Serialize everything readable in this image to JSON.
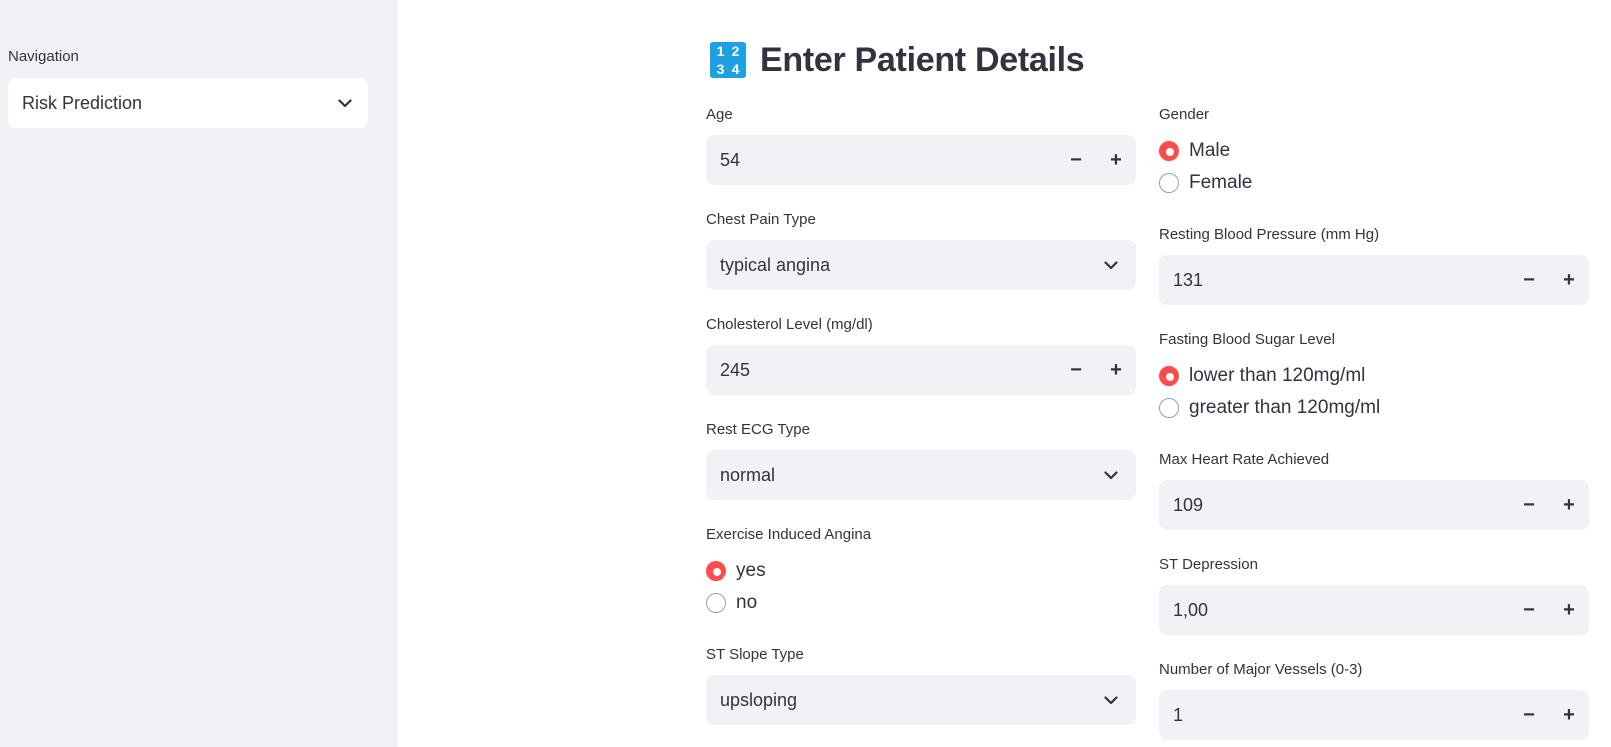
{
  "sidebar": {
    "label": "Navigation",
    "selected": "Risk Prediction"
  },
  "header": {
    "title": "Enter Patient Details",
    "icon": "input-numbers-icon",
    "icon_digits": [
      "1",
      "2",
      "3",
      "4"
    ]
  },
  "colors": {
    "sidebar_bg": "#f0f2f6",
    "input_bg": "#f0f2f6",
    "radio_selected": "#ff4b4b",
    "icon_bg": "#1da1e3"
  },
  "form": {
    "age": {
      "label": "Age",
      "value": "54"
    },
    "gender": {
      "label": "Gender",
      "options": [
        "Male",
        "Female"
      ],
      "selected": "Male"
    },
    "chest_pain": {
      "label": "Chest Pain Type",
      "value": "typical angina"
    },
    "resting_bp": {
      "label": "Resting Blood Pressure (mm Hg)",
      "value": "131"
    },
    "cholesterol": {
      "label": "Cholesterol Level (mg/dl)",
      "value": "245"
    },
    "fbs": {
      "label": "Fasting Blood Sugar Level",
      "options": [
        "lower than 120mg/ml",
        "greater than 120mg/ml"
      ],
      "selected": "lower than 120mg/ml"
    },
    "rest_ecg": {
      "label": "Rest ECG Type",
      "value": "normal"
    },
    "max_hr": {
      "label": "Max Heart Rate Achieved",
      "value": "109"
    },
    "exang": {
      "label": "Exercise Induced Angina",
      "options": [
        "yes",
        "no"
      ],
      "selected": "yes"
    },
    "st_depression": {
      "label": "ST Depression",
      "value": "1,00"
    },
    "st_slope": {
      "label": "ST Slope Type",
      "value": "upsloping"
    },
    "vessels": {
      "label": "Number of Major Vessels (0-3)",
      "value": "1"
    },
    "stepper_minus": "−",
    "stepper_plus": "+"
  }
}
